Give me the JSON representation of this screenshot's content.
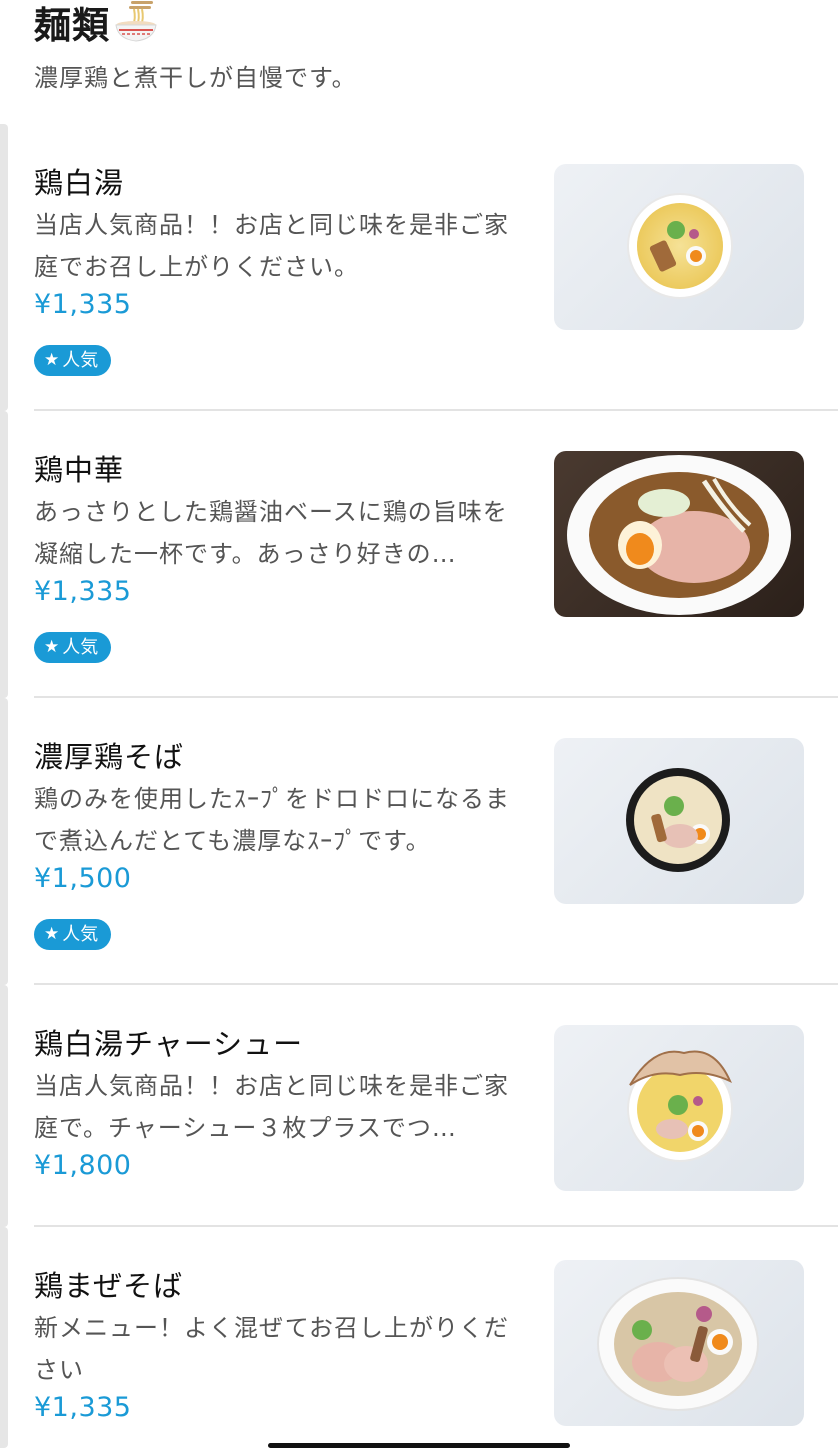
{
  "section": {
    "title": "麺類",
    "icon": "ramen-bowl-icon",
    "subtitle": "濃厚鶏と煮干しが自慢です。"
  },
  "items": [
    {
      "name": "鶏白湯",
      "description": "当店人気商品！！お店と同じ味を是非ご家庭でお召し上がりください。",
      "price": "¥1,335",
      "badge": "人気",
      "image": "chicken-paitan-ramen-photo"
    },
    {
      "name": "鶏中華",
      "description": "あっさりとした鶏醤油ベースに鶏の旨味を凝縮した一杯です。あっさり好きの…",
      "price": "¥1,335",
      "badge": "人気",
      "image": "chicken-shoyu-ramen-photo"
    },
    {
      "name": "濃厚鶏そば",
      "description": "鶏のみを使用したｽｰﾌﾟをドロドロになるまで煮込んだとても濃厚なｽｰﾌﾟです。",
      "price": "¥1,500",
      "badge": "人気",
      "image": "rich-chicken-soba-photo"
    },
    {
      "name": "鶏白湯チャーシュー",
      "description": "当店人気商品！！お店と同じ味を是非ご家庭で。チャーシュー３枚プラスでつ…",
      "price": "¥1,800",
      "badge": "",
      "image": "chicken-paitan-chashu-ramen-photo"
    },
    {
      "name": "鶏まぜそば",
      "description": "新メニュー！よく混ぜてお召し上がりください",
      "price": "¥1,335",
      "badge": "",
      "image": "chicken-mazesoba-photo"
    }
  ],
  "colors": {
    "accent": "#1a9ad6",
    "text_primary": "#111111",
    "text_secondary": "#555555",
    "divider": "#e3e3e3"
  }
}
